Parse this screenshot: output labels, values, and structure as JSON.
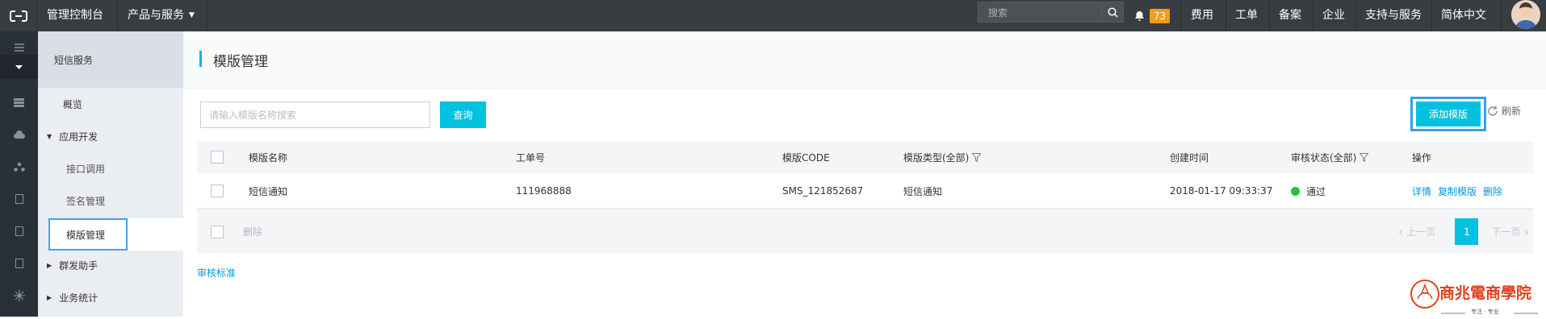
{
  "topbar": {
    "logo_icon": "aliyun-logo-icon",
    "console": "管理控制台",
    "products": "产品与服务",
    "search_placeholder": "搜索",
    "notification_count": "73",
    "nav": [
      "费用",
      "工单",
      "备案",
      "企业",
      "支持与服务",
      "简体中文"
    ]
  },
  "sidebar": {
    "title": "短信服务",
    "items": {
      "overview": "概览",
      "app_dev": "应用开发",
      "api_call": "接口调用",
      "sign_manage": "签名管理",
      "template_manage": "模版管理",
      "group_send": "群发助手",
      "stats": "业务统计"
    }
  },
  "page": {
    "title": "模版管理",
    "search_placeholder": "请输入模版名称搜索",
    "query_button": "查询",
    "add_button": "添加模版",
    "refresh": "刷新"
  },
  "table": {
    "headers": {
      "name": "模版名称",
      "ticket": "工单号",
      "code": "模版CODE",
      "type": "模版类型(全部)",
      "created": "创建时间",
      "status": "审核状态(全部)",
      "actions": "操作"
    },
    "rows": [
      {
        "name": "短信通知",
        "ticket": "111968888",
        "code": "SMS_121852687",
        "type": "短信通知",
        "created": "2018-01-17 09:33:37",
        "status": "通过",
        "actions": [
          "详情",
          "复制模版",
          "删除"
        ]
      }
    ],
    "footer": {
      "delete": "删除",
      "prev": "上一页",
      "page": "1",
      "next": "下一页"
    }
  },
  "audit_standard": "审核标准",
  "watermark": {
    "title": "商兆電商學院",
    "subtitle": "专注 · 专业"
  },
  "colors": {
    "topbar": "#373d41",
    "accent": "#00c1de",
    "link": "#0099e0",
    "badge": "#f89b1b",
    "status_ok": "#1ec53b",
    "watermark": "#e2401c"
  }
}
